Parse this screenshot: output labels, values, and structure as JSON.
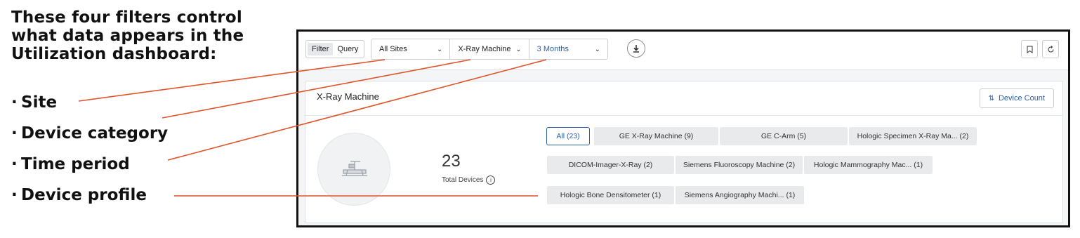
{
  "annotation": {
    "intro": "These four filters control what data appears in the Utilization dashboard:",
    "bullets": [
      "Site",
      "Device category",
      "Time period",
      "Device profile"
    ],
    "bullet_glyph": "·",
    "line_color": "#e0542a"
  },
  "toolbar": {
    "mode_filter": "Filter",
    "mode_query": "Query",
    "filters": [
      {
        "value": "All Sites"
      },
      {
        "value": "X-Ray Machine"
      },
      {
        "value": "3 Months"
      }
    ],
    "download_icon": "download-icon",
    "bookmark_icon": "bookmark-icon",
    "reset_icon": "refresh-icon"
  },
  "panel": {
    "title": "X-Ray Machine",
    "device_count_button": "Device Count",
    "total_number": "23",
    "total_label": "Total Devices",
    "info_glyph": "i",
    "chips": [
      {
        "label": "All (23)",
        "selected": true
      },
      {
        "label": "GE X-Ray Machine (9)"
      },
      {
        "label": "GE C-Arm (5)"
      },
      {
        "label": "Hologic Specimen X-Ray Ma...  (2)"
      },
      {
        "label": "DICOM-Imager-X-Ray (2)"
      },
      {
        "label": "Siemens Fluoroscopy Machine (2)"
      },
      {
        "label": "Hologic Mammography Mac...  (1)"
      },
      {
        "label": "Hologic Bone Densitometer (1)"
      },
      {
        "label": "Siemens Angiography Machi...  (1)"
      }
    ]
  },
  "colors": {
    "accent": "#2c5fa8",
    "annotation": "#e0542a"
  }
}
